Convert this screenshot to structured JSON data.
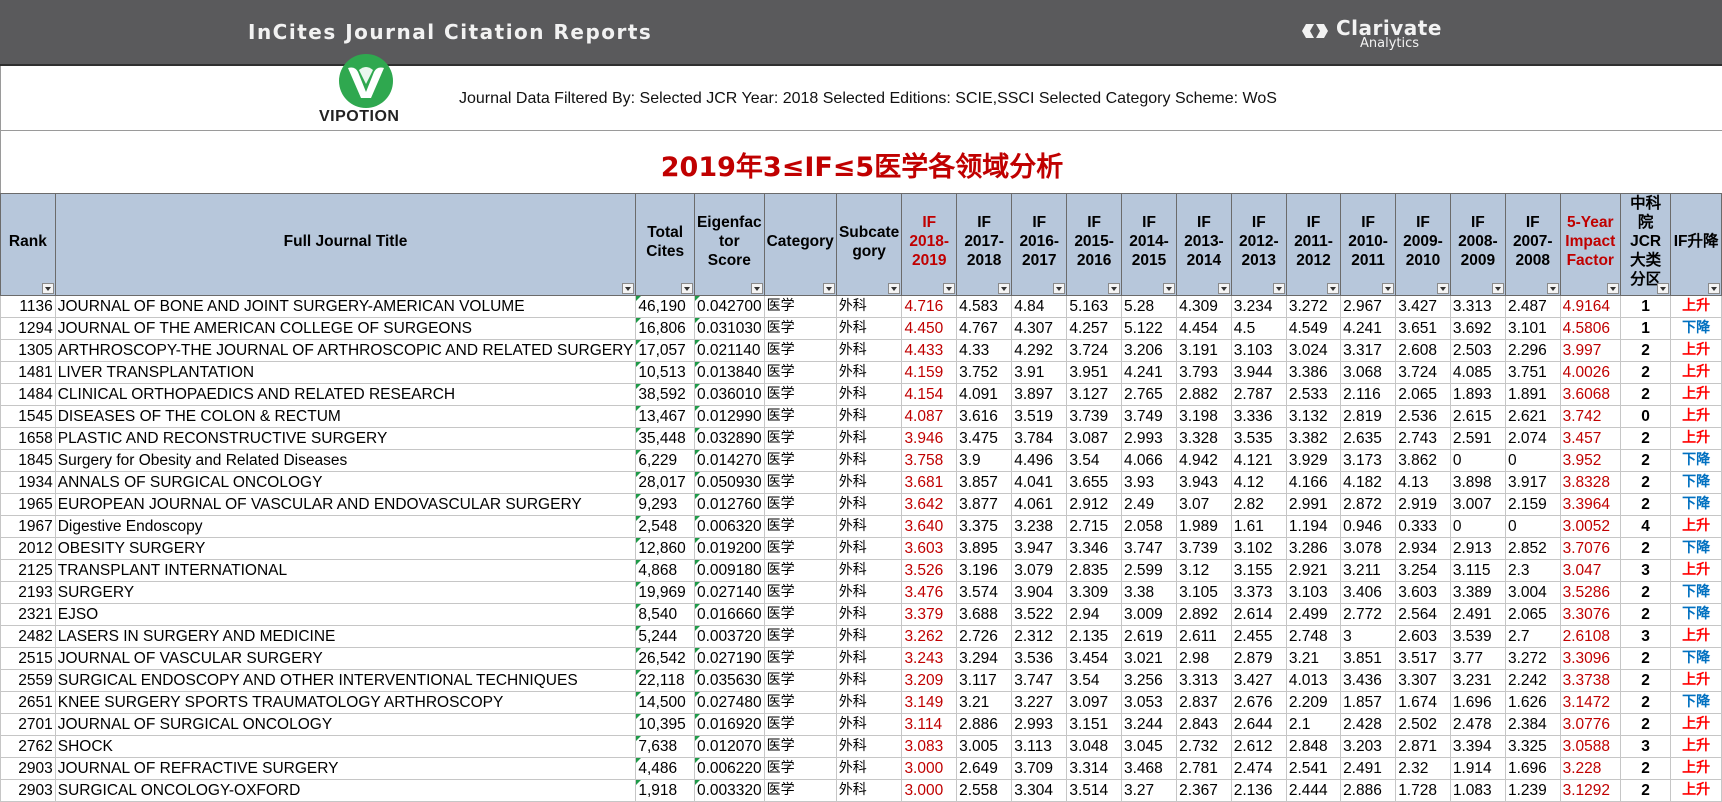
{
  "banner": {
    "app_title": "InCites Journal Citation Reports",
    "brand_name": "Clarivate",
    "brand_sub": "Analytics"
  },
  "logo": {
    "text": "VIPOTION",
    "color": "#2fa84f"
  },
  "filter_text": "Journal Data Filtered By:  Selected JCR Year: 2018 Selected Editions: SCIE,SSCI Selected Category Scheme: WoS",
  "report_title": "2019年3≤IF≤5医学各领域分析",
  "colors": {
    "header_bg": "#b7c7db",
    "highlight_red": "#c00000",
    "up_red": "#ff0000",
    "down_blue": "#0070c0"
  },
  "table": {
    "headers": [
      {
        "lines": [
          "Rank"
        ]
      },
      {
        "lines": [
          "Full Journal Title"
        ]
      },
      {
        "lines": [
          "Total",
          "Cites"
        ]
      },
      {
        "lines": [
          "Eigenfac",
          "tor",
          "Score"
        ]
      },
      {
        "lines": [
          "Category"
        ]
      },
      {
        "lines": [
          "Subcate",
          "gory"
        ]
      },
      {
        "lines": [
          "IF 2018-",
          "2019"
        ],
        "red": true
      },
      {
        "lines": [
          "IF 2017-",
          "2018"
        ]
      },
      {
        "lines": [
          "IF 2016-",
          "2017"
        ]
      },
      {
        "lines": [
          "IF 2015-",
          "2016"
        ]
      },
      {
        "lines": [
          "IF 2014-",
          "2015"
        ]
      },
      {
        "lines": [
          "IF 2013-",
          "2014"
        ]
      },
      {
        "lines": [
          "IF 2012-",
          "2013"
        ]
      },
      {
        "lines": [
          "IF 2011-",
          "2012"
        ]
      },
      {
        "lines": [
          "IF 2010-",
          "2011"
        ]
      },
      {
        "lines": [
          "IF 2009-",
          "2010"
        ]
      },
      {
        "lines": [
          "IF 2008-",
          "2009"
        ]
      },
      {
        "lines": [
          "IF 2007-",
          "2008"
        ]
      },
      {
        "lines": [
          "5-Year",
          "Impact",
          "Factor"
        ],
        "red": true
      },
      {
        "lines": [
          "中科院",
          "JCR大类",
          "分区"
        ]
      },
      {
        "lines": [
          "IF升降"
        ]
      }
    ],
    "rows": [
      [
        "1136",
        "JOURNAL OF BONE AND JOINT SURGERY-AMERICAN VOLUME",
        "46,190",
        "0.042700",
        "医学",
        "外科",
        "4.716",
        "4.583",
        "4.84",
        "5.163",
        "5.28",
        "4.309",
        "3.234",
        "3.272",
        "2.967",
        "3.427",
        "3.313",
        "2.487",
        "4.9164",
        "1",
        "上升"
      ],
      [
        "1294",
        "JOURNAL OF THE AMERICAN COLLEGE OF SURGEONS",
        "16,806",
        "0.031030",
        "医学",
        "外科",
        "4.450",
        "4.767",
        "4.307",
        "4.257",
        "5.122",
        "4.454",
        "4.5",
        "4.549",
        "4.241",
        "3.651",
        "3.692",
        "3.101",
        "4.5806",
        "1",
        "下降"
      ],
      [
        "1305",
        "ARTHROSCOPY-THE JOURNAL OF ARTHROSCOPIC AND RELATED SURGERY",
        "17,057",
        "0.021140",
        "医学",
        "外科",
        "4.433",
        "4.33",
        "4.292",
        "3.724",
        "3.206",
        "3.191",
        "3.103",
        "3.024",
        "3.317",
        "2.608",
        "2.503",
        "2.296",
        "3.997",
        "2",
        "上升"
      ],
      [
        "1481",
        "LIVER TRANSPLANTATION",
        "10,513",
        "0.013840",
        "医学",
        "外科",
        "4.159",
        "3.752",
        "3.91",
        "3.951",
        "4.241",
        "3.793",
        "3.944",
        "3.386",
        "3.068",
        "3.724",
        "4.085",
        "3.751",
        "4.0026",
        "2",
        "上升"
      ],
      [
        "1484",
        "CLINICAL ORTHOPAEDICS AND RELATED RESEARCH",
        "38,592",
        "0.036010",
        "医学",
        "外科",
        "4.154",
        "4.091",
        "3.897",
        "3.127",
        "2.765",
        "2.882",
        "2.787",
        "2.533",
        "2.116",
        "2.065",
        "1.893",
        "1.891",
        "3.6068",
        "2",
        "上升"
      ],
      [
        "1545",
        "DISEASES OF THE COLON & RECTUM",
        "13,467",
        "0.012990",
        "医学",
        "外科",
        "4.087",
        "3.616",
        "3.519",
        "3.739",
        "3.749",
        "3.198",
        "3.336",
        "3.132",
        "2.819",
        "2.536",
        "2.615",
        "2.621",
        "3.742",
        "0",
        "上升"
      ],
      [
        "1658",
        "PLASTIC AND RECONSTRUCTIVE SURGERY",
        "35,448",
        "0.032890",
        "医学",
        "外科",
        "3.946",
        "3.475",
        "3.784",
        "3.087",
        "2.993",
        "3.328",
        "3.535",
        "3.382",
        "2.635",
        "2.743",
        "2.591",
        "2.074",
        "3.457",
        "2",
        "上升"
      ],
      [
        "1845",
        "Surgery for Obesity and Related Diseases",
        "6,229",
        "0.014270",
        "医学",
        "外科",
        "3.758",
        "3.9",
        "4.496",
        "3.54",
        "4.066",
        "4.942",
        "4.121",
        "3.929",
        "3.173",
        "3.862",
        "0",
        "0",
        "3.952",
        "2",
        "下降"
      ],
      [
        "1934",
        "ANNALS OF SURGICAL ONCOLOGY",
        "28,017",
        "0.050930",
        "医学",
        "外科",
        "3.681",
        "3.857",
        "4.041",
        "3.655",
        "3.93",
        "3.943",
        "4.12",
        "4.166",
        "4.182",
        "4.13",
        "3.898",
        "3.917",
        "3.8328",
        "2",
        "下降"
      ],
      [
        "1965",
        "EUROPEAN JOURNAL OF VASCULAR AND ENDOVASCULAR SURGERY",
        "9,293",
        "0.012760",
        "医学",
        "外科",
        "3.642",
        "3.877",
        "4.061",
        "2.912",
        "2.49",
        "3.07",
        "2.82",
        "2.991",
        "2.872",
        "2.919",
        "3.007",
        "2.159",
        "3.3964",
        "2",
        "下降"
      ],
      [
        "1967",
        "Digestive Endoscopy",
        "2,548",
        "0.006320",
        "医学",
        "外科",
        "3.640",
        "3.375",
        "3.238",
        "2.715",
        "2.058",
        "1.989",
        "1.61",
        "1.194",
        "0.946",
        "0.333",
        "0",
        "0",
        "3.0052",
        "4",
        "上升"
      ],
      [
        "2012",
        "OBESITY SURGERY",
        "12,860",
        "0.019200",
        "医学",
        "外科",
        "3.603",
        "3.895",
        "3.947",
        "3.346",
        "3.747",
        "3.739",
        "3.102",
        "3.286",
        "3.078",
        "2.934",
        "2.913",
        "2.852",
        "3.7076",
        "2",
        "下降"
      ],
      [
        "2125",
        "TRANSPLANT INTERNATIONAL",
        "4,868",
        "0.009180",
        "医学",
        "外科",
        "3.526",
        "3.196",
        "3.079",
        "2.835",
        "2.599",
        "3.12",
        "3.155",
        "2.921",
        "3.211",
        "3.254",
        "3.115",
        "2.3",
        "3.047",
        "3",
        "上升"
      ],
      [
        "2193",
        "SURGERY",
        "19,969",
        "0.027140",
        "医学",
        "外科",
        "3.476",
        "3.574",
        "3.904",
        "3.309",
        "3.38",
        "3.105",
        "3.373",
        "3.103",
        "3.406",
        "3.603",
        "3.389",
        "3.004",
        "3.5286",
        "2",
        "下降"
      ],
      [
        "2321",
        "EJSO",
        "8,540",
        "0.016660",
        "医学",
        "外科",
        "3.379",
        "3.688",
        "3.522",
        "2.94",
        "3.009",
        "2.892",
        "2.614",
        "2.499",
        "2.772",
        "2.564",
        "2.491",
        "2.065",
        "3.3076",
        "2",
        "下降"
      ],
      [
        "2482",
        "LASERS IN SURGERY AND MEDICINE",
        "5,244",
        "0.003720",
        "医学",
        "外科",
        "3.262",
        "2.726",
        "2.312",
        "2.135",
        "2.619",
        "2.611",
        "2.455",
        "2.748",
        "3",
        "2.603",
        "3.539",
        "2.7",
        "2.6108",
        "3",
        "上升"
      ],
      [
        "2515",
        "JOURNAL OF VASCULAR SURGERY",
        "26,542",
        "0.027190",
        "医学",
        "外科",
        "3.243",
        "3.294",
        "3.536",
        "3.454",
        "3.021",
        "2.98",
        "2.879",
        "3.21",
        "3.851",
        "3.517",
        "3.77",
        "3.272",
        "3.3096",
        "2",
        "下降"
      ],
      [
        "2559",
        "SURGICAL ENDOSCOPY AND OTHER INTERVENTIONAL TECHNIQUES",
        "22,118",
        "0.035630",
        "医学",
        "外科",
        "3.209",
        "3.117",
        "3.747",
        "3.54",
        "3.256",
        "3.313",
        "3.427",
        "4.013",
        "3.436",
        "3.307",
        "3.231",
        "2.242",
        "3.3738",
        "2",
        "上升"
      ],
      [
        "2651",
        "KNEE SURGERY SPORTS TRAUMATOLOGY ARTHROSCOPY",
        "14,500",
        "0.027480",
        "医学",
        "外科",
        "3.149",
        "3.21",
        "3.227",
        "3.097",
        "3.053",
        "2.837",
        "2.676",
        "2.209",
        "1.857",
        "1.674",
        "1.696",
        "1.626",
        "3.1472",
        "2",
        "下降"
      ],
      [
        "2701",
        "JOURNAL OF SURGICAL ONCOLOGY",
        "10,395",
        "0.016920",
        "医学",
        "外科",
        "3.114",
        "2.886",
        "2.993",
        "3.151",
        "3.244",
        "2.843",
        "2.644",
        "2.1",
        "2.428",
        "2.502",
        "2.478",
        "2.384",
        "3.0776",
        "2",
        "上升"
      ],
      [
        "2762",
        "SHOCK",
        "7,638",
        "0.012070",
        "医学",
        "外科",
        "3.083",
        "3.005",
        "3.113",
        "3.048",
        "3.045",
        "2.732",
        "2.612",
        "2.848",
        "3.203",
        "2.871",
        "3.394",
        "3.325",
        "3.0588",
        "3",
        "上升"
      ],
      [
        "2903",
        "JOURNAL OF REFRACTIVE SURGERY",
        "4,486",
        "0.006220",
        "医学",
        "外科",
        "3.000",
        "2.649",
        "3.709",
        "3.314",
        "3.468",
        "2.781",
        "2.474",
        "2.541",
        "2.491",
        "2.32",
        "1.914",
        "1.696",
        "3.228",
        "2",
        "上升"
      ],
      [
        "2903",
        "SURGICAL ONCOLOGY-OXFORD",
        "1,918",
        "0.003320",
        "医学",
        "外科",
        "3.000",
        "2.558",
        "3.304",
        "3.514",
        "3.27",
        "2.367",
        "2.136",
        "2.444",
        "2.886",
        "1.728",
        "1.083",
        "1.239",
        "3.1292",
        "2",
        "上升"
      ]
    ]
  }
}
